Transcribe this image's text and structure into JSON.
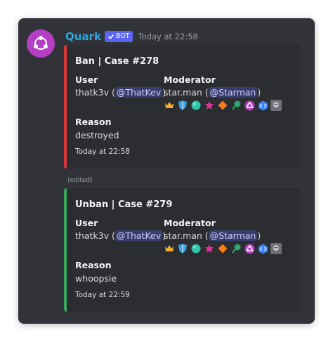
{
  "message": {
    "author": "Quark",
    "bot_tag": "BOT",
    "timestamp": "Today at 22:58",
    "edited_label": "(edited)"
  },
  "embeds": [
    {
      "title": "Ban | Case #278",
      "accent": "#da373c",
      "user_label": "User",
      "user_name": "thatk3v",
      "user_mention": "@ThatKev",
      "moderator_label": "Moderator",
      "moderator_name": "star.man",
      "moderator_mention": "@Starman",
      "reason_label": "Reason",
      "reason": "destroyed",
      "footer": "Today at 22:58"
    },
    {
      "title": "Unban | Case #279",
      "accent": "#3ba55c",
      "user_label": "User",
      "user_name": "thatk3v",
      "user_mention": "@ThatKev",
      "moderator_label": "Moderator",
      "moderator_name": "star.man",
      "moderator_mention": "@Starman",
      "reason_label": "Reason",
      "reason": "whoopsie",
      "footer": "Today at 22:59"
    }
  ],
  "badges": [
    "crown-icon",
    "shield-icon",
    "orb-icon",
    "star-icon",
    "diamond-icon",
    "quest-icon",
    "nitro-icon",
    "dev-icon",
    "avatar-icon"
  ]
}
